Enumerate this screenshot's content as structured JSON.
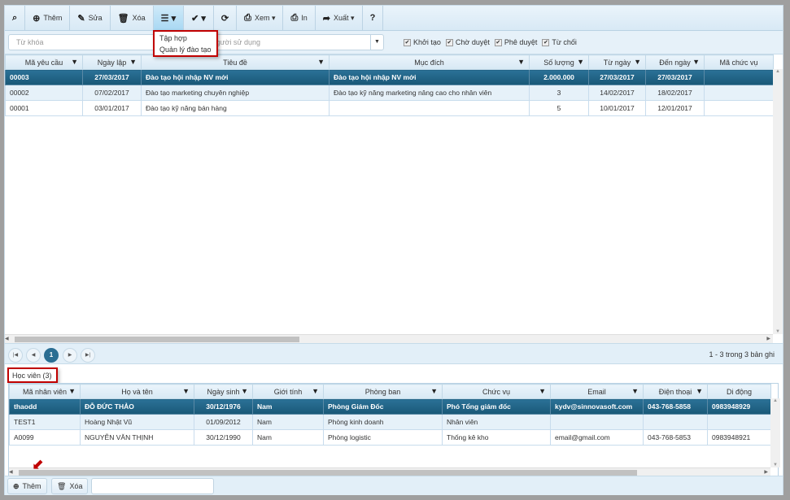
{
  "toolbar": {
    "items": [
      {
        "icon": "binoculars-icon",
        "glyph": "⌕",
        "label": ""
      },
      {
        "icon": "plus-circle-icon",
        "glyph": "⊕",
        "label": "Thêm"
      },
      {
        "icon": "pencil-icon",
        "glyph": "✎",
        "label": "Sửa"
      },
      {
        "icon": "trash-icon",
        "glyph": "🗑",
        "label": "Xóa"
      },
      {
        "icon": "menu-icon",
        "glyph": "☰ ▾",
        "label": ""
      },
      {
        "icon": "check-circle-icon",
        "glyph": "✔ ▾",
        "label": ""
      },
      {
        "icon": "refresh-icon",
        "glyph": "⟳",
        "label": ""
      },
      {
        "icon": "print-icon",
        "glyph": "⎙",
        "label": "Xem ▾"
      },
      {
        "icon": "print-icon",
        "glyph": "⎙",
        "label": "In"
      },
      {
        "icon": "share-icon",
        "glyph": "➦",
        "label": "Xuất ▾"
      },
      {
        "icon": "help-icon",
        "glyph": "?",
        "label": ""
      }
    ]
  },
  "menu": {
    "items": [
      "Tập hợp",
      "Quản lý đào tạo"
    ]
  },
  "filter": {
    "keyword_placeholder": "Từ khóa",
    "user_placeholder": "Người sử dụng",
    "user_visible": "ười sử dụng",
    "checks": [
      {
        "label": "Khởi tạo",
        "checked": true
      },
      {
        "label": "Chờ duyệt",
        "checked": true
      },
      {
        "label": "Phê duyệt",
        "checked": true
      },
      {
        "label": "Từ chối",
        "checked": true
      }
    ]
  },
  "grid1": {
    "columns": [
      "Mã yêu cầu",
      "Ngày lập",
      "Tiêu đề",
      "Mục đích",
      "Số lượng",
      "Từ ngày",
      "Đến ngày",
      "Mã chức vụ"
    ],
    "filterable": [
      true,
      true,
      true,
      true,
      true,
      true,
      true,
      false
    ],
    "align": [
      "l",
      "c",
      "l",
      "l",
      "c",
      "c",
      "c",
      "l"
    ],
    "rows": [
      [
        "00003",
        "27/03/2017",
        "Đào tạo hội nhập NV mới",
        "Đào tạo hội nhập NV mới",
        "2.000.000",
        "27/03/2017",
        "27/03/2017",
        ""
      ],
      [
        "00002",
        "07/02/2017",
        "Đào tạo marketing chuyên nghiệp",
        "Đào tạo kỹ năng marketing nâng cao cho nhân viên",
        "3",
        "14/02/2017",
        "18/02/2017",
        ""
      ],
      [
        "00001",
        "03/01/2017",
        "Đào tạo kỹ năng bán hàng",
        "",
        "5",
        "10/01/2017",
        "12/01/2017",
        ""
      ]
    ],
    "selected_row": 0
  },
  "pager": {
    "current": "1",
    "info": "1 - 3 trong 3 bản ghi"
  },
  "tab": {
    "label": "Học viên (3)"
  },
  "grid2": {
    "columns": [
      "Mã nhân viên",
      "Họ và tên",
      "Ngày sinh",
      "Giới tính",
      "Phòng ban",
      "Chức vụ",
      "Email",
      "Điện thoại",
      "Di động"
    ],
    "filterable": [
      true,
      true,
      true,
      true,
      true,
      true,
      true,
      true,
      false
    ],
    "align": [
      "l",
      "l",
      "c",
      "l",
      "l",
      "l",
      "l",
      "l",
      "l"
    ],
    "rows": [
      [
        "thaodd",
        "ĐỖ ĐỨC THẢO",
        "30/12/1976",
        "Nam",
        "Phòng Giám Đốc",
        "Phó Tổng giám đốc",
        "kydv@sinnovasoft.com",
        "043-768-5858",
        "0983948929"
      ],
      [
        "TEST1",
        "Hoàng Nhật Vũ",
        "01/09/2012",
        "Nam",
        "Phòng kinh doanh",
        "Nhân viên",
        "",
        "",
        ""
      ],
      [
        "A0099",
        "NGUYỄN VĂN THỊNH",
        "30/12/1990",
        "Nam",
        "Phòng logistic",
        "Thống kê kho",
        "email@gmail.com",
        "043-768-5853",
        "0983948921"
      ]
    ],
    "selected_row": 0
  },
  "bottom": {
    "add_label": "Thêm",
    "delete_label": "Xóa"
  },
  "colors": {
    "selected_row": "#1e5f80",
    "highlight_border": "#c00000",
    "toolbar_bg": "#dcecf7"
  }
}
